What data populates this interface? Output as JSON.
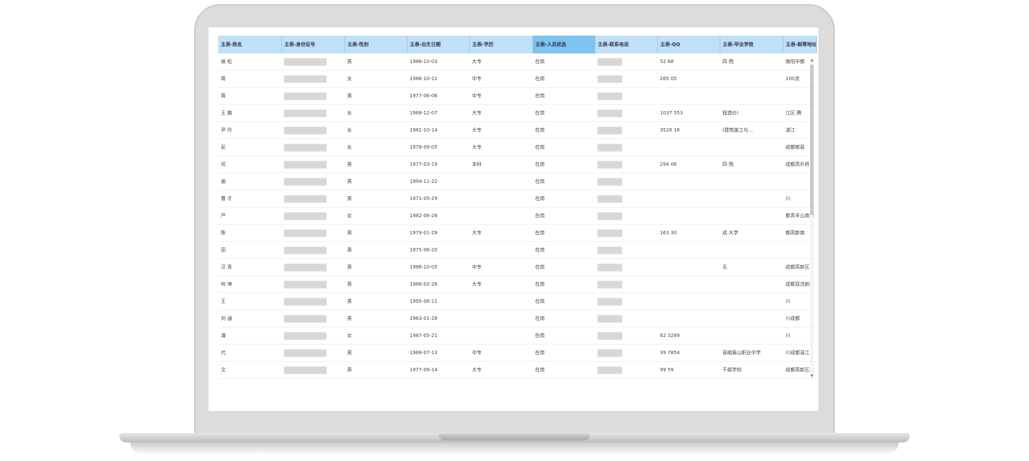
{
  "columns": [
    "主表-姓名",
    "主表-身份证号",
    "主表-性别",
    "主表-出生日期",
    "主表-学历",
    "主表-人员状态",
    "主表-联系电话",
    "主表-QQ",
    "主表-毕业学校",
    "主表-邮寄地址"
  ],
  "active_column": 5,
  "rows": [
    {
      "name": "侯 松",
      "gender": "男",
      "birth": "1986-10-03",
      "edu": "大专",
      "status": "在岗",
      "qq": "52 68",
      "school": "四 院",
      "addr": "南阳中都"
    },
    {
      "name": "蒋",
      "gender": "女",
      "birth": "1986-10-11",
      "edu": "中专",
      "status": "在岗",
      "qq": "265 05",
      "school": "",
      "addr": "100流"
    },
    {
      "name": "蒋",
      "gender": "男",
      "birth": "1977-06-06",
      "edu": "中专",
      "status": "在岗",
      "qq": "",
      "school": "",
      "addr": ""
    },
    {
      "name": "王 趣",
      "gender": "女",
      "birth": "1988-12-07",
      "edu": "大专",
      "status": "在岗",
      "qq": "1037 553",
      "school": "程造价)",
      "addr": "江区 腾"
    },
    {
      "name": "尹 玲",
      "gender": "女",
      "birth": "1981-10-14",
      "edu": "大专",
      "status": "在岗",
      "qq": "3526 16",
      "school": "(建筑施工与...",
      "addr": "湛江"
    },
    {
      "name": "彭",
      "gender": "女",
      "birth": "1978-09-05",
      "edu": "大专",
      "status": "在岗",
      "qq": "",
      "school": "",
      "addr": "成都郫县"
    },
    {
      "name": "司",
      "gender": "男",
      "birth": "1977-03-19",
      "edu": "本科",
      "status": "在岗",
      "qq": "294 06",
      "school": "四 院",
      "addr": "成都高升桥"
    },
    {
      "name": "谢",
      "gender": "男",
      "birth": "1994-11-22",
      "edu": "",
      "status": "在岗",
      "qq": "",
      "school": "",
      "addr": ""
    },
    {
      "name": "曹 才",
      "gender": "男",
      "birth": "1971-05-29",
      "edu": "",
      "status": "在岗",
      "qq": "",
      "school": "",
      "addr": "川"
    },
    {
      "name": "严",
      "gender": "女",
      "birth": "1982-06-26",
      "edu": "",
      "status": "在岗",
      "qq": "",
      "school": "",
      "addr": "都青羊山商场"
    },
    {
      "name": "陈",
      "gender": "男",
      "birth": "1979-01-29",
      "edu": "大专",
      "status": "在岗",
      "qq": "163 30",
      "school": "成 大学",
      "addr": "都高新南"
    },
    {
      "name": "田",
      "gender": "男",
      "birth": "1975-06-20",
      "edu": "",
      "status": "在岗",
      "qq": "",
      "school": "",
      "addr": ""
    },
    {
      "name": "汪 青",
      "gender": "男",
      "birth": "1986-10-05",
      "edu": "中专",
      "status": "在岗",
      "qq": "",
      "school": "无",
      "addr": "成都高新区"
    },
    {
      "name": "何 坤",
      "gender": "男",
      "birth": "1986-02-26",
      "edu": "大专",
      "status": "在岗",
      "qq": "",
      "school": "",
      "addr": "成都双流新区"
    },
    {
      "name": "王",
      "gender": "男",
      "birth": "1995-06-11",
      "edu": "",
      "status": "在岗",
      "qq": "",
      "school": "",
      "addr": "川"
    },
    {
      "name": "刘 通",
      "gender": "男",
      "birth": "1963-01-28",
      "edu": "",
      "status": "在岗",
      "qq": "",
      "school": "",
      "addr": "川成都"
    },
    {
      "name": "潘",
      "gender": "女",
      "birth": "1987-05-21",
      "edu": "",
      "status": "在岗",
      "qq": "62 3289",
      "school": "",
      "addr": "川"
    },
    {
      "name": "代",
      "gender": "男",
      "birth": "1988-07-13",
      "edu": "中专",
      "status": "在岗",
      "qq": "39 7854",
      "school": "县峨眉山职业中学",
      "addr": "川成都温江"
    },
    {
      "name": "文",
      "gender": "男",
      "birth": "1977-09-14",
      "edu": "大专",
      "status": "在岗",
      "qq": "99 59",
      "school": "干部学校",
      "addr": "成都高新区大"
    }
  ]
}
